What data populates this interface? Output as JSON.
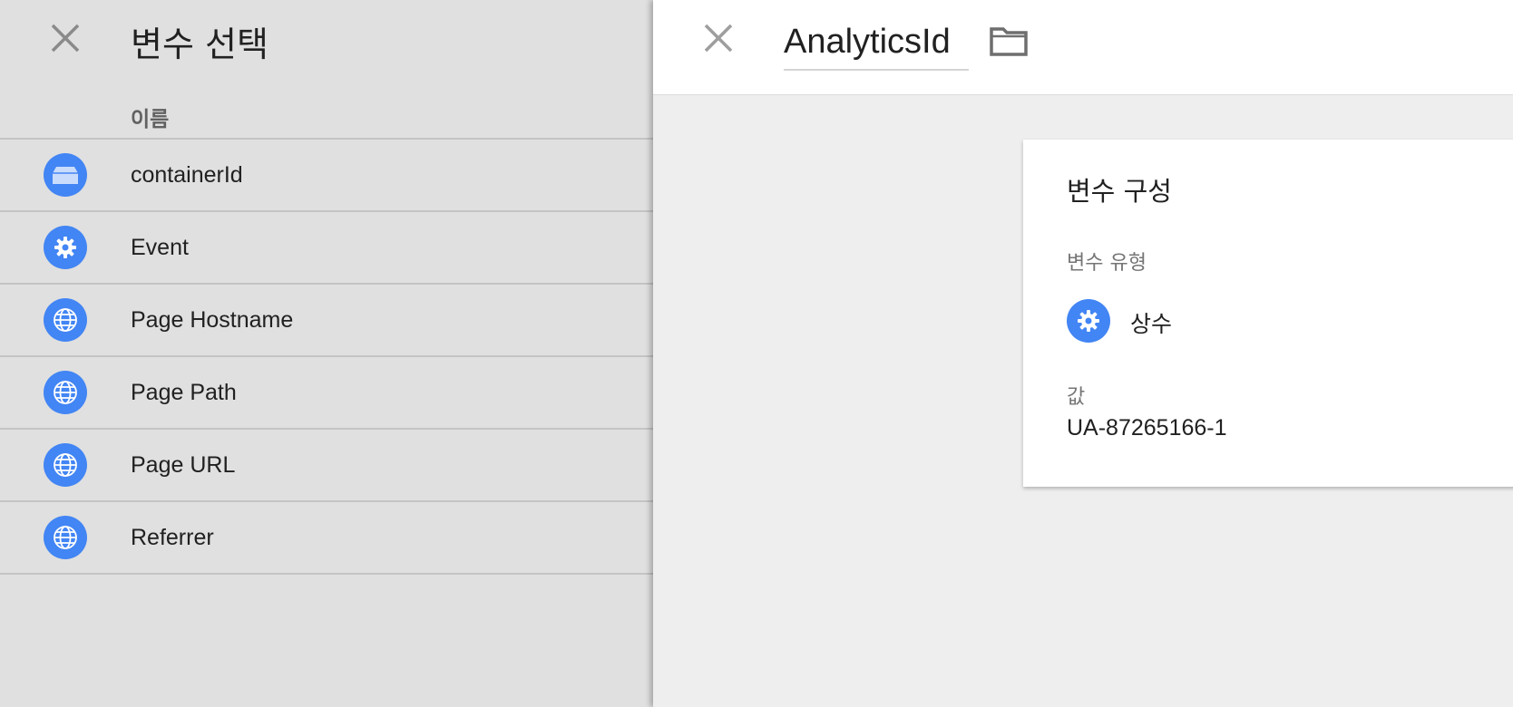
{
  "left_panel": {
    "title": "변수 선택",
    "column_header": "이름",
    "close_icon": "close-icon",
    "items": [
      {
        "label": "containerId",
        "icon": "container-icon"
      },
      {
        "label": "Event",
        "icon": "gear-icon"
      },
      {
        "label": "Page Hostname",
        "icon": "globe-icon"
      },
      {
        "label": "Page Path",
        "icon": "globe-icon"
      },
      {
        "label": "Page URL",
        "icon": "globe-icon"
      },
      {
        "label": "Referrer",
        "icon": "globe-icon"
      }
    ]
  },
  "right_panel": {
    "close_icon": "close-icon",
    "variable_name": "AnalyticsId",
    "folder_icon": "folder-icon",
    "card": {
      "title": "변수 구성",
      "type_label": "변수 유형",
      "type_value": "상수",
      "type_icon": "gear-icon",
      "value_label": "값",
      "value": "UA-87265166-1"
    }
  },
  "colors": {
    "accent": "#4285f4",
    "left_background": "#e0e0e0",
    "right_background": "#eeeeee",
    "card_background": "#ffffff"
  }
}
